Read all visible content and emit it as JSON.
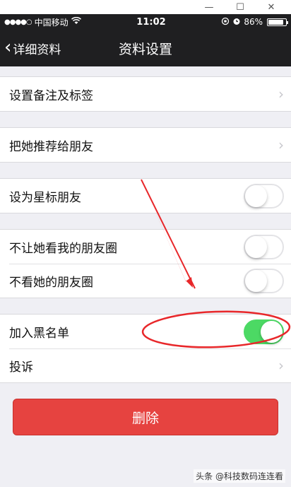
{
  "window_controls": {
    "minimize": "—",
    "maximize": "☐",
    "close": "✕"
  },
  "status_bar": {
    "signal": "●●●●○",
    "carrier": "中国移动",
    "time": "11:02",
    "battery_percent": "86%",
    "battery_level": 0.86
  },
  "nav": {
    "back_label": "详细资料",
    "title": "资料设置"
  },
  "groups": [
    {
      "rows": [
        {
          "label": "设置备注及标签",
          "control": "chevron"
        }
      ]
    },
    {
      "rows": [
        {
          "label": "把她推荐给朋友",
          "control": "chevron"
        }
      ]
    },
    {
      "rows": [
        {
          "label": "设为星标朋友",
          "control": "switch",
          "on": false
        }
      ]
    },
    {
      "rows": [
        {
          "label": "不让她看我的朋友圈",
          "control": "switch",
          "on": false
        },
        {
          "label": "不看她的朋友圈",
          "control": "switch",
          "on": false
        }
      ]
    },
    {
      "rows": [
        {
          "label": "加入黑名单",
          "control": "switch",
          "on": true
        },
        {
          "label": "投诉",
          "control": "chevron"
        }
      ]
    }
  ],
  "delete_button": {
    "label": "删除"
  },
  "watermark": "头条 @科技数码连连看",
  "colors": {
    "nav_bg": "#1f1f21",
    "page_bg": "#efeff4",
    "switch_on": "#4cd964",
    "delete_red": "#e64340",
    "annotation_red": "#e8272a"
  }
}
